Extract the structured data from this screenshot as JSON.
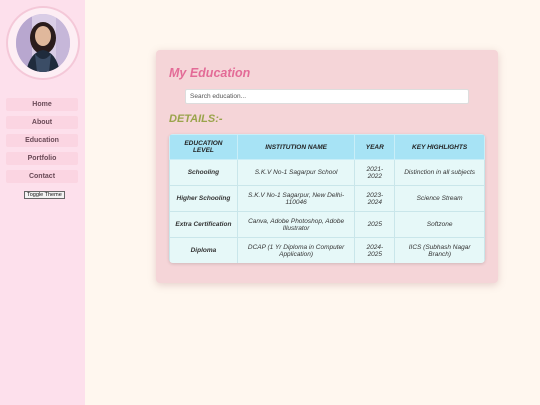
{
  "nav": {
    "items": [
      "Home",
      "About",
      "Education",
      "Portfolio",
      "Contact"
    ],
    "toggle_theme": "Toggle Theme"
  },
  "education": {
    "title": "My Education",
    "search_placeholder": "Search education...",
    "details_heading": "DETAILS:-",
    "columns": [
      "EDUCATION LEVEL",
      "INSTITUTION NAME",
      "YEAR",
      "KEY HIGHLIGHTS"
    ],
    "rows": [
      [
        "Schooling",
        "S.K.V No-1 Sagarpur School",
        "2021-2022",
        "Distinction in all subjects"
      ],
      [
        "Higher Schooling",
        "S.K.V No-1 Sagarpur, New Delhi-110046",
        "2023-2024",
        "Science Stream"
      ],
      [
        "Extra Certification",
        "Canva, Adobe Photoshop, Adobe Illustrator",
        "2025",
        "Softzone"
      ],
      [
        "Diploma",
        "DCAP (1 Yr Diploma in Computer Application)",
        "2024-2025",
        "IICS (Subhash Nagar Branch)"
      ]
    ]
  }
}
